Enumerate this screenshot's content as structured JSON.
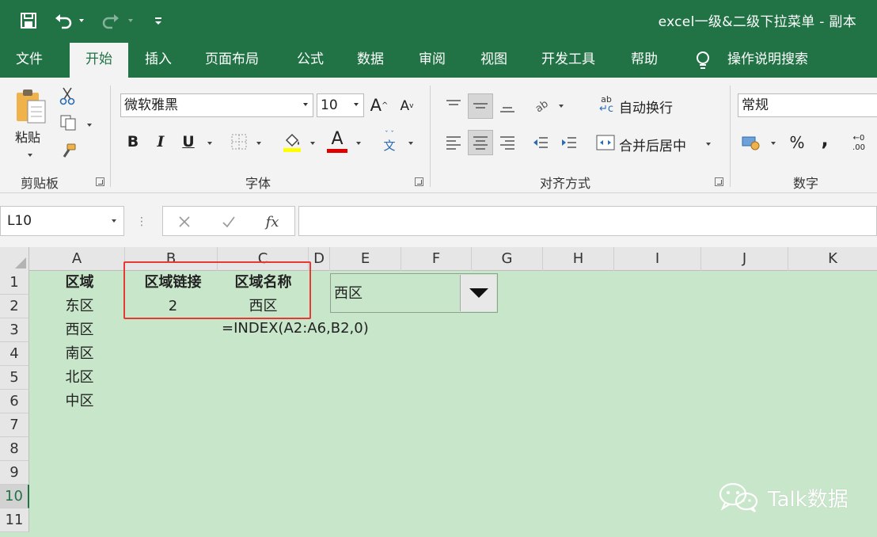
{
  "window": {
    "title": "excel一级&二级下拉菜单 - 副本"
  },
  "tabs": [
    {
      "label": "文件"
    },
    {
      "label": "开始"
    },
    {
      "label": "插入"
    },
    {
      "label": "页面布局"
    },
    {
      "label": "公式"
    },
    {
      "label": "数据"
    },
    {
      "label": "审阅"
    },
    {
      "label": "视图"
    },
    {
      "label": "开发工具"
    },
    {
      "label": "帮助"
    },
    {
      "label": "操作说明搜索"
    }
  ],
  "ribbon": {
    "clipboard": {
      "paste_label": "粘贴",
      "group_label": "剪贴板"
    },
    "font": {
      "font_name": "微软雅黑",
      "font_size": "10",
      "group_label": "字体",
      "bold": "B",
      "italic": "I",
      "underline": "U",
      "grow": "A",
      "shrink": "A",
      "font_color_letter": "A",
      "phonetic": "文"
    },
    "alignment": {
      "wrap_text": "自动换行",
      "merge_center": "合并后居中",
      "group_label": "对齐方式"
    },
    "number": {
      "format": "常规",
      "group_label": "数字",
      "percent": "%",
      "comma": ","
    }
  },
  "formula_bar": {
    "name_box": "L10",
    "fx": "fx",
    "formula": ""
  },
  "columns": [
    "A",
    "B",
    "C",
    "D",
    "E",
    "F",
    "G",
    "H",
    "I",
    "J",
    "K"
  ],
  "rows": [
    "1",
    "2",
    "3",
    "4",
    "5",
    "6",
    "7",
    "8",
    "9",
    "10",
    "11"
  ],
  "cells": {
    "A1": "区域",
    "B1": "区域链接",
    "C1": "区域名称",
    "A2": "东区",
    "B2": "2",
    "C2": "西区",
    "A3": "西区",
    "C3": "=INDEX(A2:A6,B2,0)",
    "A4": "南区",
    "A5": "北区",
    "A6": "中区"
  },
  "combo_control": {
    "value": "西区"
  },
  "watermark": {
    "text": "Talk数据"
  },
  "colors": {
    "excel_green": "#217346",
    "grid_bg": "#c8e6c9",
    "highlight_red": "#e53935"
  }
}
